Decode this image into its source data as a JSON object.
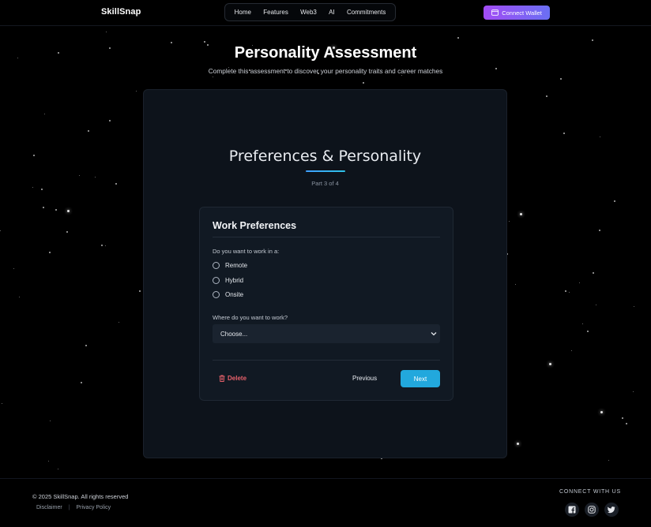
{
  "brand": "SkillSnap",
  "nav": [
    "Home",
    "Features",
    "Web3",
    "AI",
    "Commitments"
  ],
  "wallet_button": "Connect Wallet",
  "page_title": "Personality Assessment",
  "page_subtitle": "Complete this assessment to discover your personality traits and career matches",
  "section": {
    "title": "Preferences & Personality",
    "progress": "Part 3 of 4"
  },
  "card": {
    "title": "Work Preferences",
    "q1": "Do you want to work in a:",
    "options": [
      "Remote",
      "Hybrid",
      "Onsite"
    ],
    "q2": "Where do you want to work?",
    "select_value": "Choose...",
    "delete_label": "Delete",
    "previous_label": "Previous",
    "next_label": "Next"
  },
  "footer": {
    "copyright": "© 2025 SkillSnap. All rights reserved",
    "links": [
      "Disclaimer",
      "Privacy Policy"
    ],
    "separator": "|",
    "connect_label": "CONNECT WITH US",
    "social": [
      "facebook-icon",
      "instagram-icon",
      "twitter-icon"
    ]
  },
  "colors": {
    "background": "#000000",
    "panel": "#0d131b",
    "accent": "#22a8dd",
    "wallet_gradient_start": "#a24cf5",
    "wallet_gradient_end": "#6a6ff3",
    "delete": "#e8616b"
  }
}
